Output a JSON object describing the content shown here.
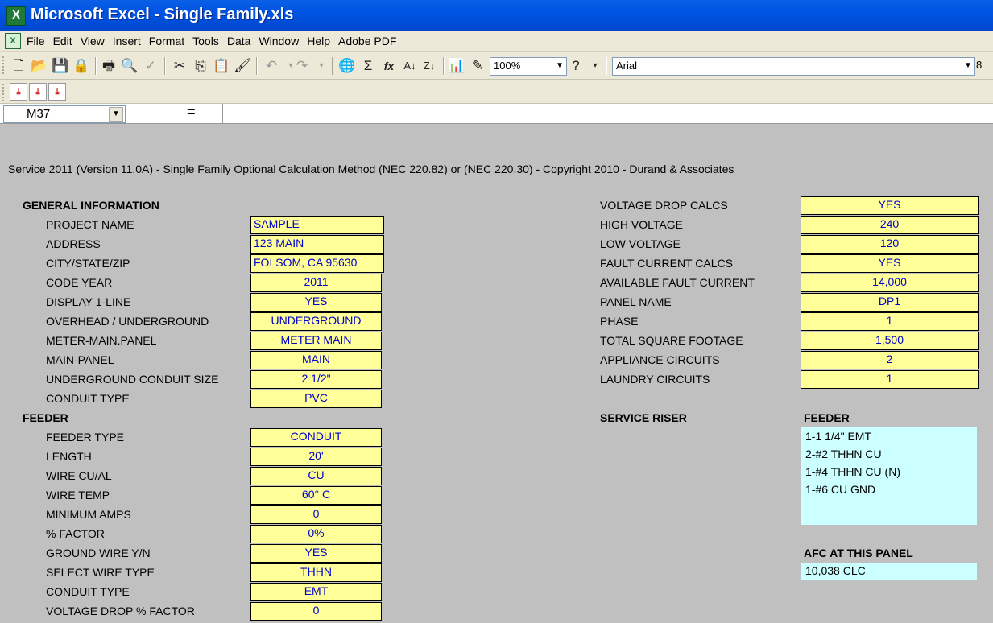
{
  "window": {
    "title": "Microsoft Excel - Single Family.xls"
  },
  "menu": [
    "File",
    "Edit",
    "View",
    "Insert",
    "Format",
    "Tools",
    "Data",
    "Window",
    "Help",
    "Adobe PDF"
  ],
  "toolbar": {
    "zoom": "100%",
    "font": "Arial",
    "font_size": "8"
  },
  "formula_bar": {
    "name_box": "M37",
    "equals": "="
  },
  "sheet": {
    "banner": "Service 2011 (Version 11.0A) - Single Family Optional Calculation Method (NEC 220.82) or (NEC 220.30) - Copyright 2010 - Durand & Associates",
    "general": {
      "header": "GENERAL INFORMATION",
      "rows": [
        {
          "label": "PROJECT NAME",
          "value": "SAMPLE"
        },
        {
          "label": "ADDRESS",
          "value": "123 MAIN"
        },
        {
          "label": "CITY/STATE/ZIP",
          "value": "FOLSOM, CA 95630"
        },
        {
          "label": "CODE YEAR",
          "value": "2011"
        },
        {
          "label": "DISPLAY 1-LINE",
          "value": "YES"
        },
        {
          "label": "OVERHEAD / UNDERGROUND",
          "value": "UNDERGROUND"
        },
        {
          "label": "METER-MAIN.PANEL",
          "value": "METER MAIN"
        },
        {
          "label": "MAIN-PANEL",
          "value": "MAIN"
        },
        {
          "label": "UNDERGROUND CONDUIT SIZE",
          "value": "2 1/2\""
        },
        {
          "label": "CONDUIT TYPE",
          "value": "PVC"
        }
      ]
    },
    "feeder": {
      "header": "FEEDER",
      "rows": [
        {
          "label": "FEEDER TYPE",
          "value": "CONDUIT"
        },
        {
          "label": "LENGTH",
          "value": "20'"
        },
        {
          "label": "WIRE CU/AL",
          "value": "CU"
        },
        {
          "label": "WIRE TEMP",
          "value": "60° C"
        },
        {
          "label": "MINIMUM AMPS",
          "value": "0"
        },
        {
          "label": "% FACTOR",
          "value": "0%"
        },
        {
          "label": "GROUND WIRE Y/N",
          "value": "YES"
        },
        {
          "label": "SELECT WIRE TYPE",
          "value": "THHN"
        },
        {
          "label": "CONDUIT TYPE",
          "value": "EMT"
        },
        {
          "label": "VOLTAGE DROP % FACTOR",
          "value": "0"
        }
      ]
    },
    "right": {
      "rows": [
        {
          "label": "VOLTAGE DROP CALCS",
          "value": "YES"
        },
        {
          "label": "HIGH VOLTAGE",
          "value": "240"
        },
        {
          "label": "LOW VOLTAGE",
          "value": "120"
        },
        {
          "label": "FAULT CURRENT CALCS",
          "value": "YES"
        },
        {
          "label": "AVAILABLE FAULT CURRENT",
          "value": "14,000"
        },
        {
          "label": "PANEL NAME",
          "value": "DP1"
        },
        {
          "label": "PHASE",
          "value": "1"
        },
        {
          "label": "TOTAL SQUARE FOOTAGE",
          "value": "1,500"
        },
        {
          "label": "APPLIANCE CIRCUITS",
          "value": "2"
        },
        {
          "label": "LAUNDRY CIRCUITS",
          "value": "1"
        }
      ]
    },
    "service_riser": {
      "header": "SERVICE RISER",
      "feeder_header": "FEEDER",
      "lines": [
        "1-1 1/4\" EMT",
        "2-#2 THHN CU",
        "1-#4 THHN CU (N)",
        "1-#6 CU GND"
      ]
    },
    "afc": {
      "header": "AFC AT THIS PANEL",
      "value": "10,038 CLC"
    }
  }
}
